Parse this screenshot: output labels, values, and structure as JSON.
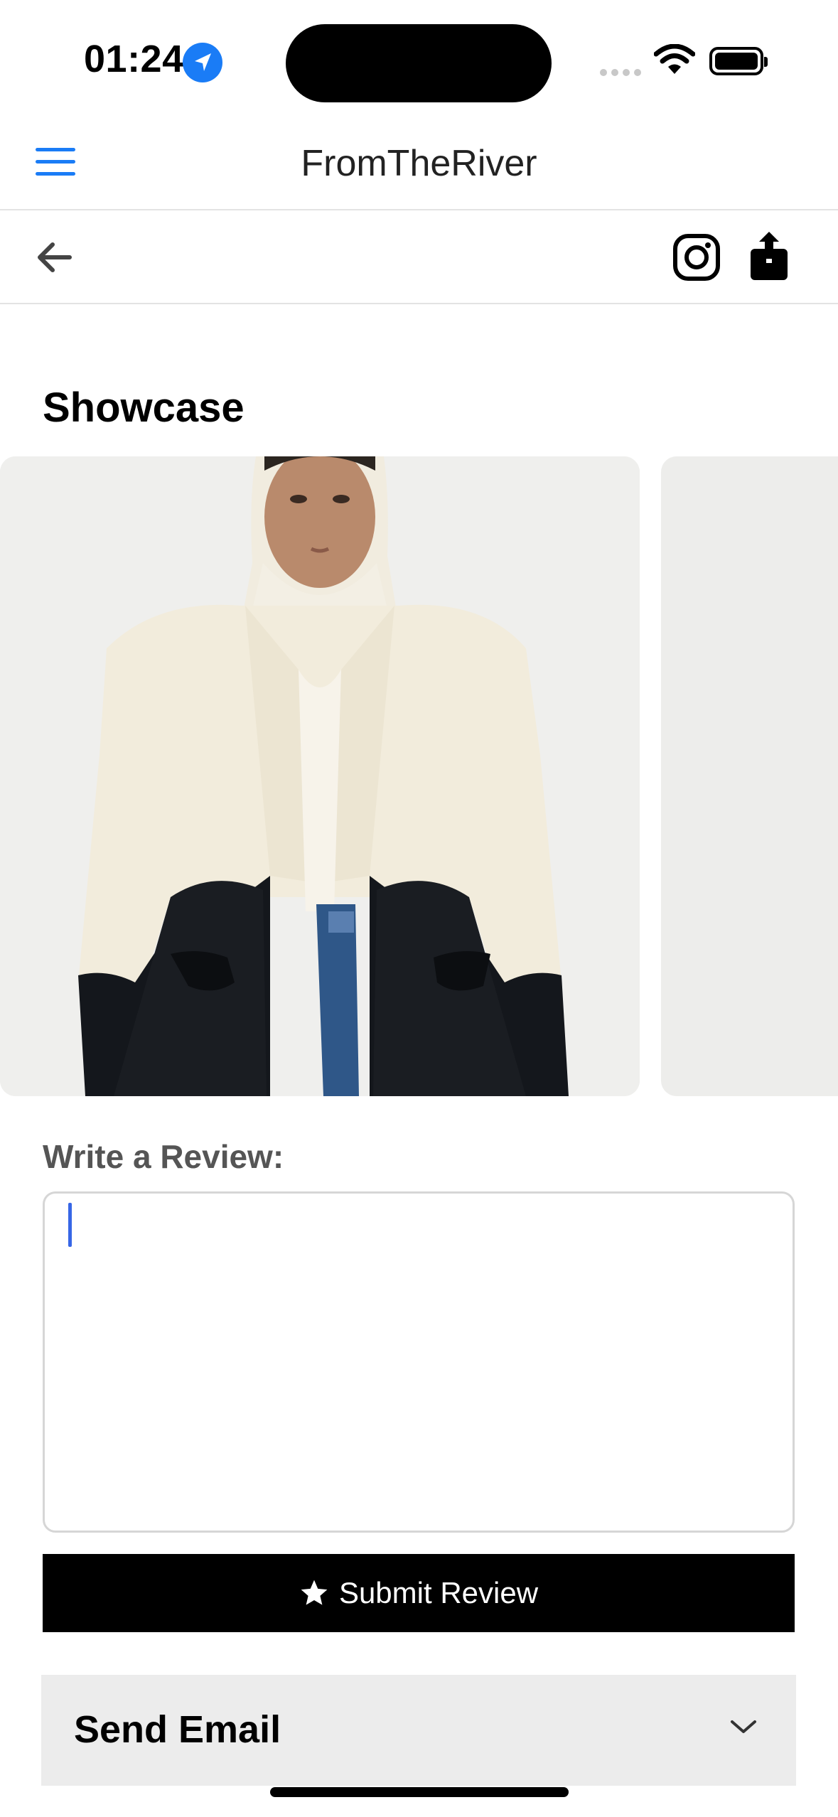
{
  "status_bar": {
    "time": "01:24",
    "icons": [
      "location-arrow-icon",
      "signal-dots-icon",
      "wifi-icon",
      "battery-icon"
    ]
  },
  "header": {
    "title": "FromTheRiver",
    "menu_icon": "hamburger-menu-icon"
  },
  "toolbar": {
    "icons": [
      "back-arrow-icon",
      "instagram-icon",
      "share-icon"
    ]
  },
  "showcase": {
    "title": "Showcase"
  },
  "review": {
    "label": "Write a Review:",
    "value": "",
    "submit_label": "Submit Review",
    "submit_icon": "star-icon"
  },
  "email_section": {
    "title": "Send Email",
    "icon": "chevron-down-icon"
  },
  "colors": {
    "accent": "#1a7cf6",
    "caret": "#3766e6",
    "button_bg": "#000000",
    "panel_bg": "#ececec"
  }
}
